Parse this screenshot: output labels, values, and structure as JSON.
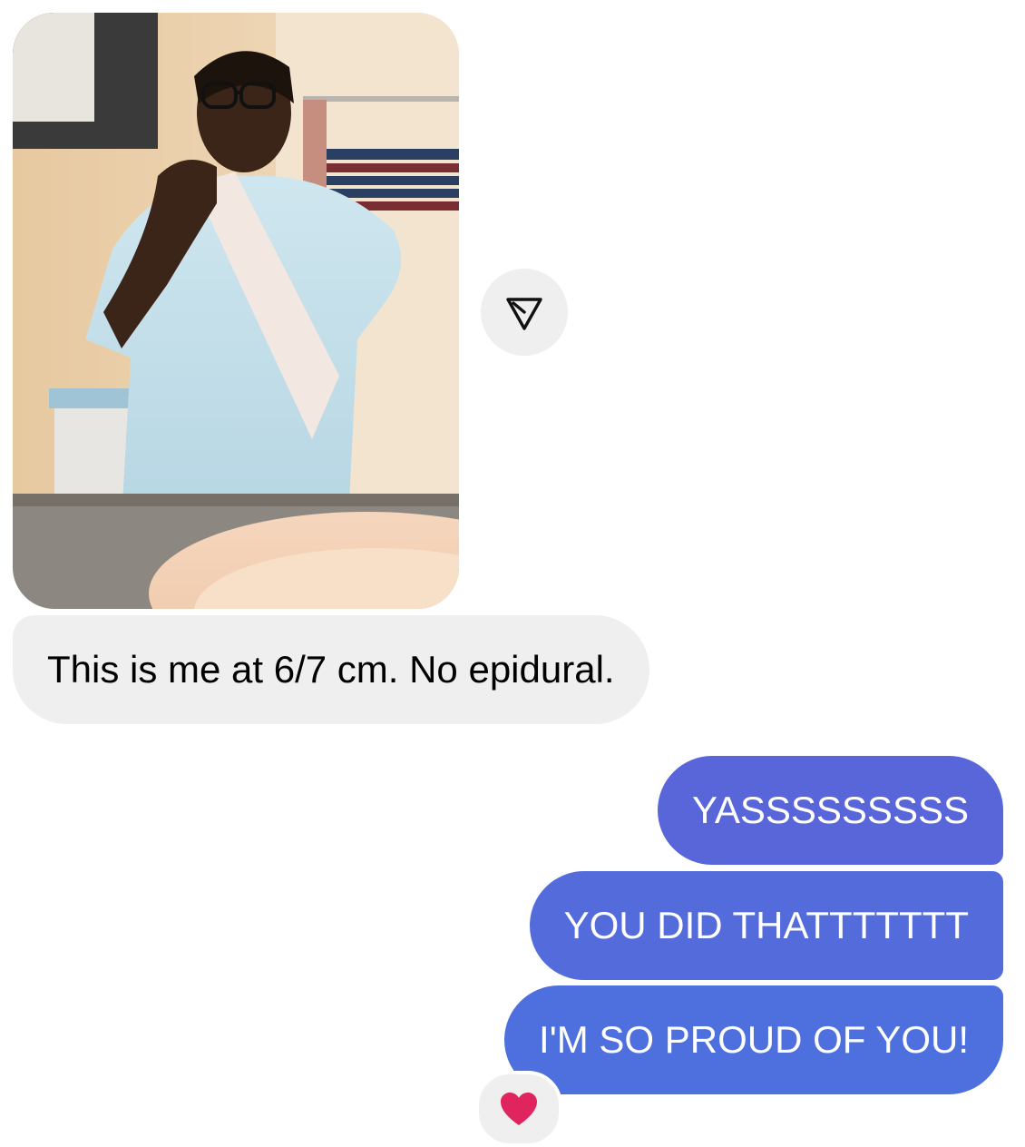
{
  "thread": {
    "incoming": {
      "photo_icon": "photo",
      "share_icon": "paper-plane-icon",
      "text": "This is me at 6/7 cm. No epidural."
    },
    "outgoing": [
      {
        "text": "YASSSSSSSSS"
      },
      {
        "text": "YOU DID THATTTTTTT"
      },
      {
        "text": "I'M SO PROUD OF YOU!"
      }
    ],
    "reaction": {
      "icon": "red-heart-icon",
      "color": "#e0245e"
    }
  },
  "colors": {
    "incoming_bubble": "#efefef",
    "outgoing_gradient": [
      "#5966da",
      "#546bdc",
      "#4e70de"
    ]
  }
}
